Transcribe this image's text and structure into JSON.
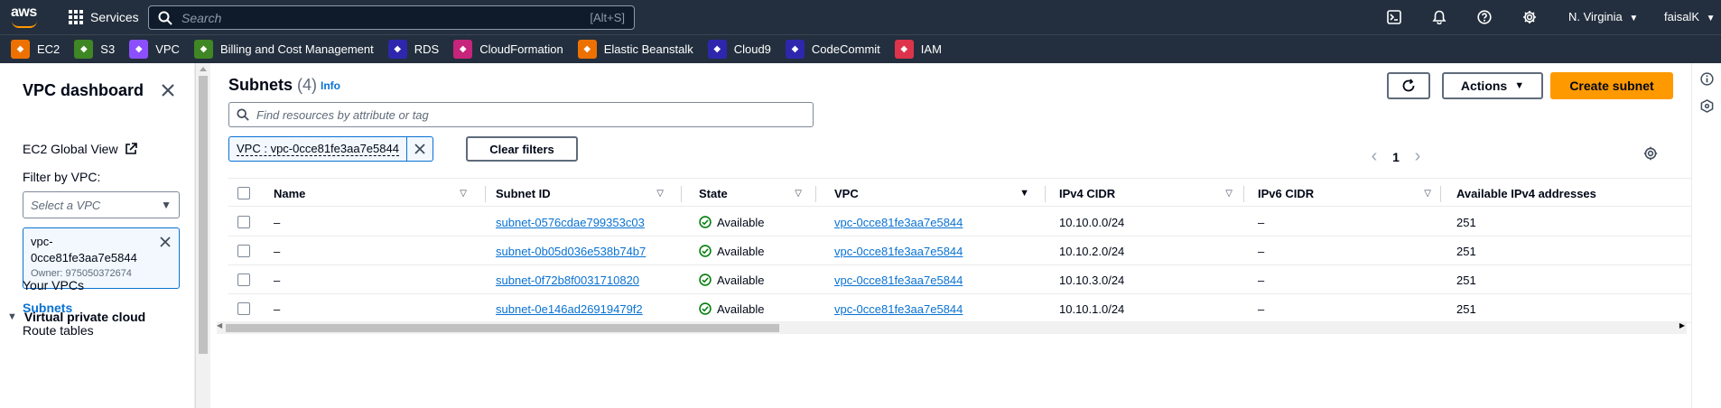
{
  "topnav": {
    "services_label": "Services",
    "search_placeholder": "Search",
    "search_hint": "[Alt+S]",
    "region": "N. Virginia",
    "user": "faisalK"
  },
  "favorites": [
    {
      "label": "EC2",
      "color": "#ed7100"
    },
    {
      "label": "S3",
      "color": "#3f8624"
    },
    {
      "label": "VPC",
      "color": "#8c4fff"
    },
    {
      "label": "Billing and Cost Management",
      "color": "#3f8624"
    },
    {
      "label": "RDS",
      "color": "#2e27ad"
    },
    {
      "label": "CloudFormation",
      "color": "#c7247b"
    },
    {
      "label": "Elastic Beanstalk",
      "color": "#ed7100"
    },
    {
      "label": "Cloud9",
      "color": "#2e27ad"
    },
    {
      "label": "CodeCommit",
      "color": "#2e27ad"
    },
    {
      "label": "IAM",
      "color": "#dd344c"
    }
  ],
  "sidenav": {
    "title": "VPC dashboard",
    "ec2_global": "EC2 Global View",
    "filter_label": "Filter by VPC:",
    "select_placeholder": "Select a VPC",
    "selected_vpc": "vpc-0cce81fe3aa7e5844",
    "selected_vpc_line1": "vpc-",
    "selected_vpc_line2": "0cce81fe3aa7e5844",
    "owner": "Owner: 975050372674",
    "section": "Virtual private cloud",
    "items": [
      "Your VPCs",
      "Subnets",
      "Route tables"
    ]
  },
  "main": {
    "title": "Subnets",
    "count": "(4)",
    "info": "Info",
    "refresh_label": "",
    "actions_label": "Actions",
    "create_label": "Create subnet",
    "search_placeholder": "Find resources by attribute or tag",
    "filter_token": "VPC : vpc-0cce81fe3aa7e5844",
    "clear_filters": "Clear filters",
    "page": "1"
  },
  "table": {
    "columns": [
      "Name",
      "Subnet ID",
      "State",
      "VPC",
      "IPv4 CIDR",
      "IPv6 CIDR",
      "Available IPv4 addresses"
    ],
    "rows": [
      {
        "name": "–",
        "subnet_id": "subnet-0576cdae799353c03",
        "state": "Available",
        "vpc": "vpc-0cce81fe3aa7e5844",
        "ipv4": "10.10.0.0/24",
        "ipv6": "–",
        "avail": "251"
      },
      {
        "name": "–",
        "subnet_id": "subnet-0b05d036e538b74b7",
        "state": "Available",
        "vpc": "vpc-0cce81fe3aa7e5844",
        "ipv4": "10.10.2.0/24",
        "ipv6": "–",
        "avail": "251"
      },
      {
        "name": "–",
        "subnet_id": "subnet-0f72b8f0031710820",
        "state": "Available",
        "vpc": "vpc-0cce81fe3aa7e5844",
        "ipv4": "10.10.3.0/24",
        "ipv6": "–",
        "avail": "251"
      },
      {
        "name": "–",
        "subnet_id": "subnet-0e146ad26919479f2",
        "state": "Available",
        "vpc": "vpc-0cce81fe3aa7e5844",
        "ipv4": "10.10.1.0/24",
        "ipv6": "–",
        "avail": "251"
      }
    ]
  },
  "colors": {
    "nav_bg": "#232f3e",
    "accent": "#ff9900",
    "link": "#0972d3",
    "success": "#037f0c"
  }
}
